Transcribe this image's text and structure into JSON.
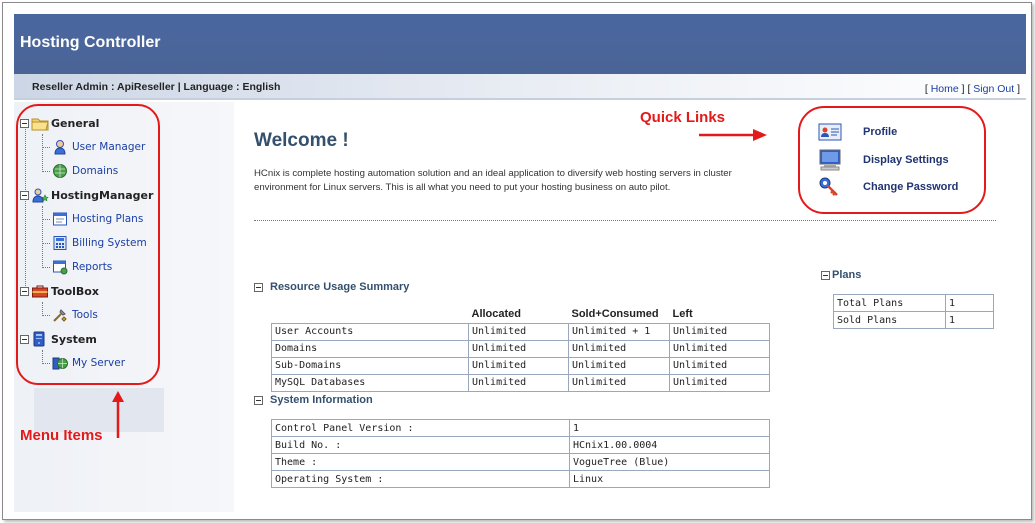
{
  "app": {
    "title": "Hosting Controller"
  },
  "subbar": {
    "user_info": "Reseller Admin : ApiReseller | Language : English",
    "link_open": "[ ",
    "home": "Home",
    "link_mid": " ] [ ",
    "sign_out": "Sign Out",
    "link_close": " ]"
  },
  "sidebar": {
    "groups": [
      {
        "label": "General",
        "icon": "folder-icon",
        "items": [
          {
            "label": "User Manager",
            "icon": "user-icon"
          },
          {
            "label": "Domains",
            "icon": "globe-icon"
          }
        ]
      },
      {
        "label": "HostingManager",
        "icon": "users-star-icon",
        "items": [
          {
            "label": "Hosting Plans",
            "icon": "plan-window-icon"
          },
          {
            "label": "Billing System",
            "icon": "calculator-icon"
          },
          {
            "label": "Reports",
            "icon": "report-icon"
          }
        ]
      },
      {
        "label": "ToolBox",
        "icon": "toolbox-icon",
        "items": [
          {
            "label": "Tools",
            "icon": "tools-icon"
          }
        ]
      },
      {
        "label": "System",
        "icon": "server-icon",
        "items": [
          {
            "label": "My Server",
            "icon": "network-globe-icon"
          }
        ]
      }
    ]
  },
  "main": {
    "welcome": "Welcome !",
    "intro": "HCnix is complete hosting automation solution and an ideal application to diversify web hosting servers in cluster environment for Linux servers. This is all what you need to put your hosting business on auto pilot."
  },
  "quick_links": [
    {
      "label": "Profile",
      "icon": "profile-card-icon"
    },
    {
      "label": "Display Settings",
      "icon": "monitor-icon"
    },
    {
      "label": "Change Password",
      "icon": "key-icon"
    }
  ],
  "annotations": {
    "quick_links": "Quick Links",
    "menu_items": "Menu Items",
    "color": "#e41a1a"
  },
  "resource_usage": {
    "title": "Resource Usage Summary",
    "columns": [
      "",
      "Allocated",
      "Sold+Consumed",
      "Left"
    ],
    "rows": [
      [
        "User Accounts",
        "Unlimited",
        "Unlimited + 1",
        "Unlimited"
      ],
      [
        "Domains",
        "Unlimited",
        "Unlimited",
        "Unlimited"
      ],
      [
        "Sub-Domains",
        "Unlimited",
        "Unlimited",
        "Unlimited"
      ],
      [
        "MySQL Databases",
        "Unlimited",
        "Unlimited",
        "Unlimited"
      ]
    ]
  },
  "system_info": {
    "title": "System Information",
    "rows": [
      [
        "Control Panel Version :",
        "1"
      ],
      [
        "Build No. :",
        "HCnix1.00.0004"
      ],
      [
        "Theme :",
        "VogueTree (Blue)"
      ],
      [
        "Operating System :",
        "Linux"
      ]
    ]
  },
  "plans": {
    "title": "Plans",
    "rows": [
      [
        "Total Plans",
        "1"
      ],
      [
        "Sold Plans",
        "1"
      ]
    ]
  },
  "colors": {
    "header": "#4a6496",
    "link": "#1a3fa5",
    "heading": "#34506e"
  }
}
